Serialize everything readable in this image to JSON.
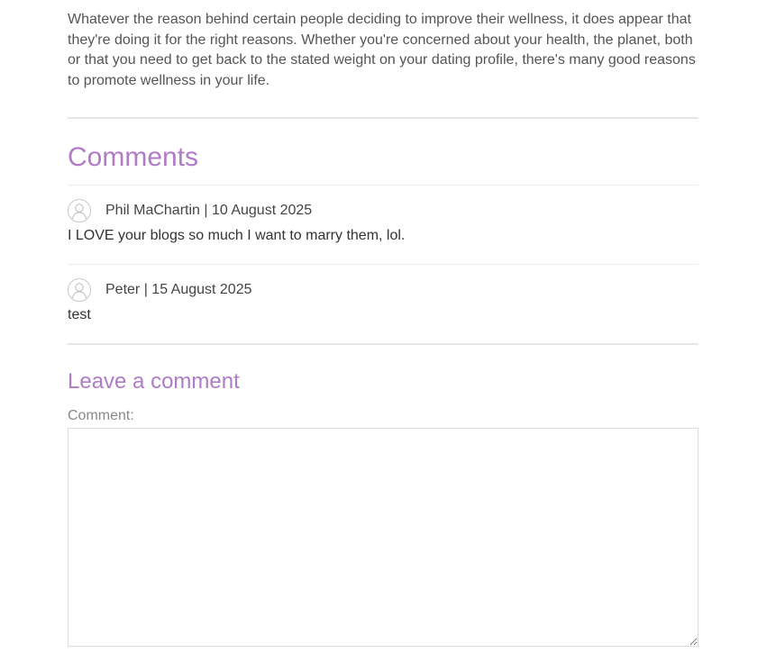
{
  "article": {
    "closing_paragraph": "Whatever the reason behind certain people deciding to improve their wellness, it does appear that they're doing it for the right reasons. Whether you're concerned about your health, the planet, both or that you need to get back to the stated weight on your dating profile, there's many good reasons to promote wellness in your life."
  },
  "comments": {
    "heading": "Comments",
    "items": [
      {
        "author": "Phil MaChartin",
        "separator": "|",
        "date": "10 August 2025",
        "meta": "Phil MaChartin | 10 August 2025",
        "text": "I LOVE your blogs so much I want to marry them, lol.",
        "avatar_icon": "user-avatar-icon"
      },
      {
        "author": "Peter",
        "separator": "|",
        "date": "15 August 2025",
        "meta": "Peter | 15 August 2025",
        "text": "test",
        "avatar_icon": "user-avatar-icon"
      }
    ]
  },
  "leave_comment": {
    "heading": "Leave a comment",
    "comment_label": "Comment:",
    "comment_value": "",
    "comment_placeholder": ""
  },
  "colors": {
    "heading_accent": "#b07cc6",
    "divider": "#e6e6e6",
    "body_text": "#333333"
  }
}
